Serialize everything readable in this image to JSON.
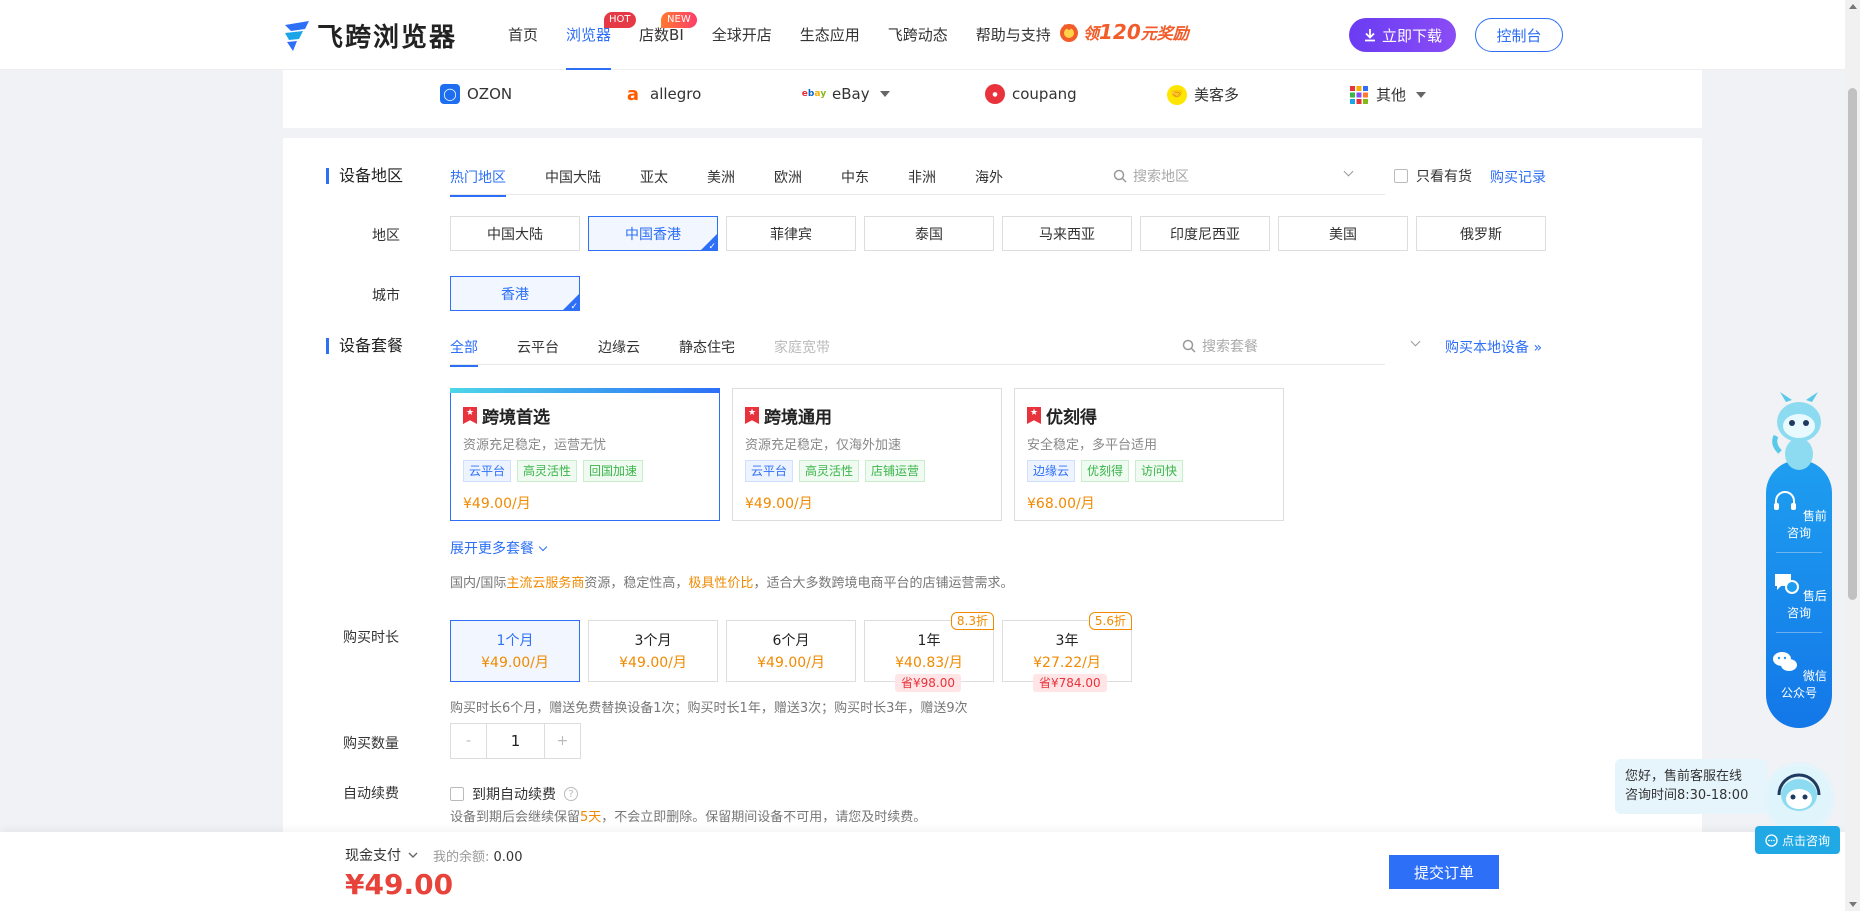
{
  "header": {
    "logo_text": "飞跨浏览器",
    "nav": [
      {
        "label": "首页"
      },
      {
        "label": "浏览器",
        "badge": "HOT"
      },
      {
        "label": "店数BI",
        "badge": "NEW"
      },
      {
        "label": "全球开店"
      },
      {
        "label": "生态应用"
      },
      {
        "label": "飞跨动态"
      },
      {
        "label": "帮助与支持"
      }
    ],
    "promo_prefix": "领",
    "promo_amount": "120",
    "promo_suffix": "元奖励",
    "download_label": "立即下载",
    "console_label": "控制台"
  },
  "platforms": [
    {
      "label": "OZON",
      "icon": "ozon-icon"
    },
    {
      "label": "allegro",
      "icon": "allegro-icon"
    },
    {
      "label": "eBay",
      "icon": "ebay-icon",
      "dropdown": true
    },
    {
      "label": "coupang",
      "icon": "coupang-icon"
    },
    {
      "label": "美客多",
      "icon": "mercado-libre-icon"
    },
    {
      "label": "其他",
      "icon": "grid-icon",
      "dropdown": true
    }
  ],
  "device_region": {
    "title": "设备地区",
    "tabs": [
      "热门地区",
      "中国大陆",
      "亚太",
      "美洲",
      "欧洲",
      "中东",
      "非洲",
      "海外"
    ],
    "active_tab": 0,
    "search_placeholder": "搜索地区",
    "in_stock_label": "只看有货",
    "purchase_record_label": "购买记录",
    "region_label": "地区",
    "regions": [
      "中国大陆",
      "中国香港",
      "菲律宾",
      "泰国",
      "马来西亚",
      "印度尼西亚",
      "美国",
      "俄罗斯"
    ],
    "selected_region": 1,
    "city_label": "城市",
    "cities": [
      "香港"
    ],
    "selected_city": 0
  },
  "package": {
    "title": "设备套餐",
    "tabs": [
      "全部",
      "云平台",
      "边缘云",
      "静态住宅",
      "家庭宽带"
    ],
    "active_tab": 0,
    "disabled_tab": 4,
    "search_placeholder": "搜索套餐",
    "local_device_link": "购买本地设备 »",
    "cards": [
      {
        "name": "跨境首选",
        "desc": "资源充足稳定，运营无忧",
        "tags": [
          {
            "t": "云平台",
            "c": "blue"
          },
          {
            "t": "高灵活性",
            "c": "green"
          },
          {
            "t": "回国加速",
            "c": "green"
          }
        ],
        "price": "¥49.00/月",
        "selected": true
      },
      {
        "name": "跨境通用",
        "desc": "资源充足稳定，仅海外加速",
        "tags": [
          {
            "t": "云平台",
            "c": "blue"
          },
          {
            "t": "高灵活性",
            "c": "green"
          },
          {
            "t": "店铺运营",
            "c": "green"
          }
        ],
        "price": "¥49.00/月",
        "selected": false
      },
      {
        "name": "优刻得",
        "desc": "安全稳定，多平台适用",
        "tags": [
          {
            "t": "边缘云",
            "c": "blue"
          },
          {
            "t": "优刻得",
            "c": "green"
          },
          {
            "t": "访问快",
            "c": "green"
          }
        ],
        "price": "¥68.00/月",
        "selected": false
      }
    ],
    "expand_label": "展开更多套餐",
    "note_parts": [
      "国内/国际",
      "主流云服务商",
      "资源，稳定性高，",
      "极具性价比",
      "，适合大多数跨境电商平台的店铺运营需求。"
    ]
  },
  "duration": {
    "label": "购买时长",
    "options": [
      {
        "name": "1个月",
        "price": "¥49.00/月",
        "discount": "",
        "save": ""
      },
      {
        "name": "3个月",
        "price": "¥49.00/月",
        "discount": "",
        "save": ""
      },
      {
        "name": "6个月",
        "price": "¥49.00/月",
        "discount": "",
        "save": ""
      },
      {
        "name": "1年",
        "price": "¥40.83/月",
        "discount": "8.3折",
        "save": "省¥98.00"
      },
      {
        "name": "3年",
        "price": "¥27.22/月",
        "discount": "5.6折",
        "save": "省¥784.00"
      }
    ],
    "selected": 0,
    "note": "购买时长6个月，赠送免费替换设备1次；购买时长1年，赠送3次；购买时长3年，赠送9次"
  },
  "quantity": {
    "label": "购买数量",
    "value": "1",
    "minus": "-",
    "plus": "+"
  },
  "auto_renew": {
    "label": "自动续费",
    "checkbox_label": "到期自动续费",
    "help": "?",
    "note_parts": [
      "设备到期后会继续保留",
      "5天",
      "，不会立即删除。保留期间设备不可用，请您及时续费。"
    ]
  },
  "footer": {
    "pay_method": "现金支付",
    "balance_label": "我的余额:",
    "balance_value": "0.00",
    "total": "¥49.00",
    "submit_label": "提交订单"
  },
  "service": {
    "items": [
      "售前咨询",
      "售后咨询",
      "微信公众号"
    ],
    "bubble_line1": "您好，售前客服在线",
    "bubble_line2": "咨询时间8:30-18:00",
    "consult_label": "点击咨询"
  },
  "colors": {
    "accent": "#2d6ff7",
    "price": "#f08a00",
    "total": "#e8433a",
    "download_gradient": "#6a3cf2"
  }
}
